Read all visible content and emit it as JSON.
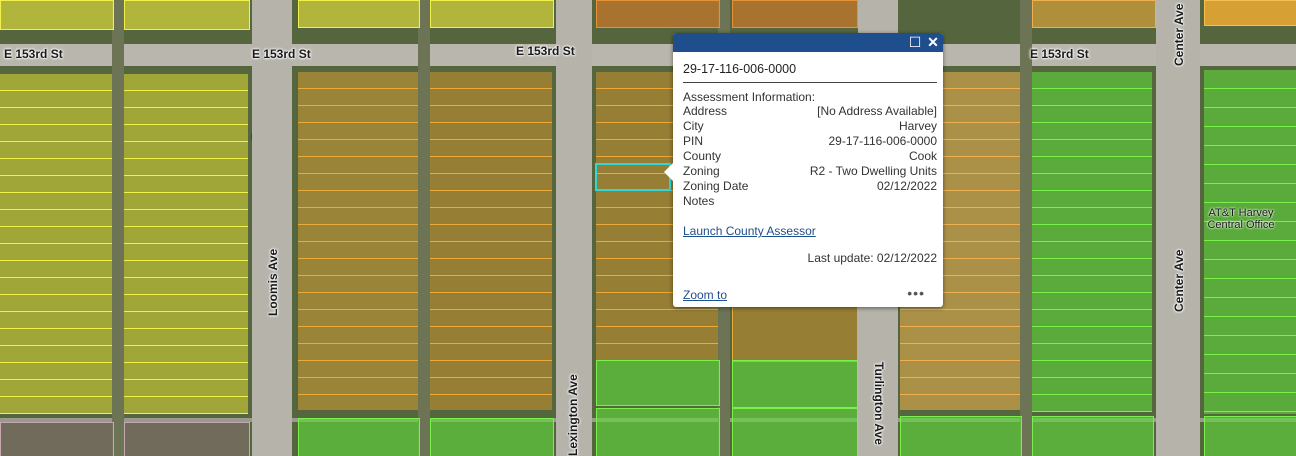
{
  "map": {
    "streets_horizontal": [
      "E 153rd St",
      "E 153rd St",
      "E 153rd St",
      "E 153rd St"
    ],
    "streets_vertical": [
      "Loomis Ave",
      "Lexington Ave",
      "Turlington Ave",
      "Center Ave",
      "Center Ave"
    ],
    "poi": "AT&T Harvey Central Office",
    "parcel_colors": {
      "yellow": "#d6d43a",
      "orange": "#c88a2e",
      "light_orange": "#e3b45a",
      "green": "#5fd83a",
      "selected_outline": "#33d6d6"
    }
  },
  "popup": {
    "title": "29-17-116-006-0000",
    "section_label": "Assessment Information:",
    "fields": [
      {
        "label": "Address",
        "value": "[No Address Available]"
      },
      {
        "label": "City",
        "value": "Harvey"
      },
      {
        "label": "PIN",
        "value": "29-17-116-006-0000"
      },
      {
        "label": "County",
        "value": "Cook"
      },
      {
        "label": "Zoning",
        "value": "R2 - Two Dwelling Units"
      },
      {
        "label": "Zoning Date",
        "value": "02/12/2022"
      },
      {
        "label": "Notes",
        "value": ""
      }
    ],
    "assessor_link": "Launch County Assessor",
    "last_update": "Last update: 02/12/2022",
    "zoom_to": "Zoom to",
    "more": "•••",
    "maximize_glyph": "☐",
    "close_glyph": "✕",
    "header_color": "#1f4e8c"
  }
}
